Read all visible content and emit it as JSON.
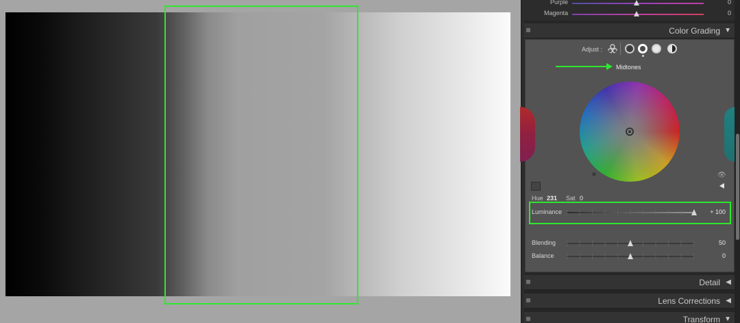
{
  "hsl": {
    "rows": [
      {
        "label": "Purple",
        "value": "0",
        "color": "#9a40c0"
      },
      {
        "label": "Magenta",
        "value": "0",
        "color": "#c040a0"
      }
    ]
  },
  "color_grading": {
    "title": "Color Grading",
    "adjust_label": "Adjust :",
    "mode_label": "Midtones",
    "hue_label": "Hue",
    "hue_value": "231",
    "sat_label": "Sat",
    "sat_value": "0",
    "luminance_label": "Luminance",
    "luminance_value": "+ 100",
    "luminance_fraction": 1.0,
    "blending_label": "Blending",
    "blending_value": "50",
    "blending_fraction": 0.5,
    "balance_label": "Balance",
    "balance_value": "0",
    "balance_fraction": 0.5
  },
  "sections": {
    "detail": "Detail",
    "lens_corrections": "Lens Corrections",
    "transform": "Transform"
  },
  "colors": {
    "annotation": "#2ee82e",
    "panel_bg": "#2c2c2c",
    "section_bg": "#535353"
  }
}
